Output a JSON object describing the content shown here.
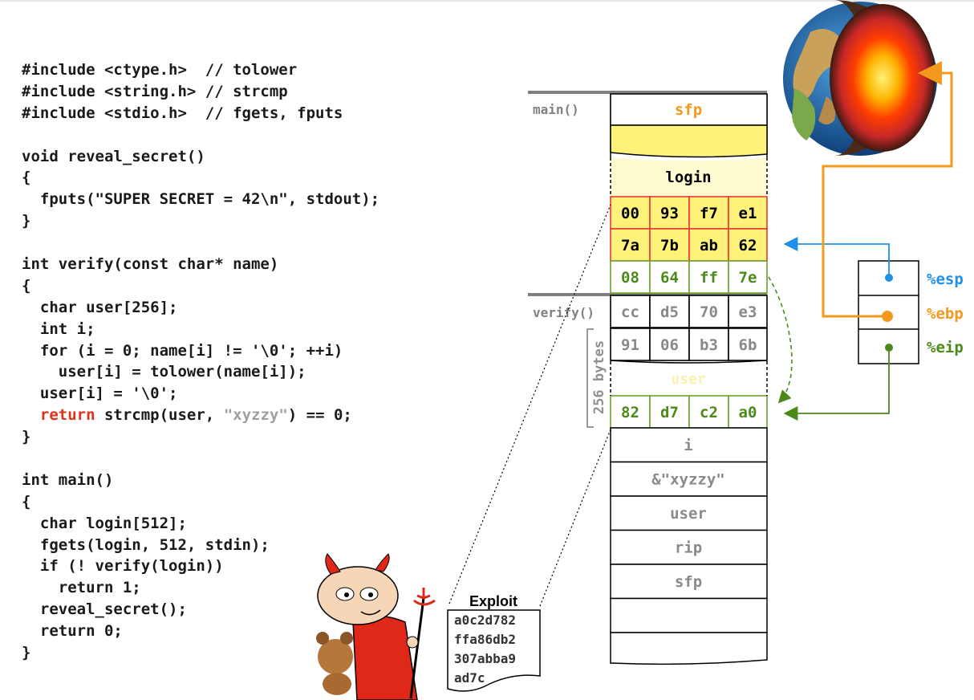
{
  "code": {
    "lines": [
      "#include <ctype.h>  // tolower",
      "#include <string.h> // strcmp",
      "#include <stdio.h>  // fgets, fputs",
      "",
      "void reveal_secret()",
      "{",
      "  fputs(\"SUPER SECRET = 42\\n\", stdout);",
      "}",
      "",
      "int verify(const char* name)",
      "{",
      "  char user[256];",
      "  int i;",
      "  for (i = 0; name[i] != '\\0'; ++i)",
      "    user[i] = tolower(name[i]);",
      "  user[i] = '\\0';",
      "",
      "}",
      "",
      "int main()",
      "{",
      "  char login[512];",
      "  fgets(login, 512, stdin);",
      "  if (! verify(login))",
      "    return 1;",
      "  reveal_secret();",
      "  return 0;",
      "}"
    ],
    "return_line": {
      "indent": "  ",
      "keyword": "return",
      "before": " strcmp(user, ",
      "literal": "\"xyzzy\"",
      "after": ") == 0;"
    }
  },
  "stack": {
    "main_label": "main()",
    "verify_label": "verify()",
    "sfp_top": "sfp",
    "login_label": "login",
    "yellow_row1": [
      "00",
      "93",
      "f7",
      "e1"
    ],
    "yellow_row2": [
      "7a",
      "7b",
      "ab",
      "62"
    ],
    "green_row_top": [
      "08",
      "64",
      "ff",
      "7e"
    ],
    "gray_row1": [
      "cc",
      "d5",
      "70",
      "e3"
    ],
    "gray_row2": [
      "91",
      "06",
      "b3",
      "6b"
    ],
    "user_faint": "user",
    "green_row_bottom": [
      "82",
      "d7",
      "c2",
      "a0"
    ],
    "bytes_label": "256 bytes",
    "lower_cells": [
      "i",
      "&\"xyzzy\"",
      "user",
      "rip",
      "sfp",
      "",
      ""
    ]
  },
  "registers": {
    "esp": "%esp",
    "ebp": "%ebp",
    "eip": "%eip"
  },
  "exploit": {
    "title": "Exploit",
    "lines": [
      "a0c2d782",
      "ffa86db2",
      "307abba9",
      "ad7c"
    ]
  },
  "colors": {
    "orange": "#f39a1e",
    "blue": "#1e90e8",
    "green": "#4b8a1a",
    "red": "#e0321c",
    "yellow": "#fff27a",
    "light_yellow": "#fffbd0",
    "gray_text": "#8a8a8a"
  }
}
